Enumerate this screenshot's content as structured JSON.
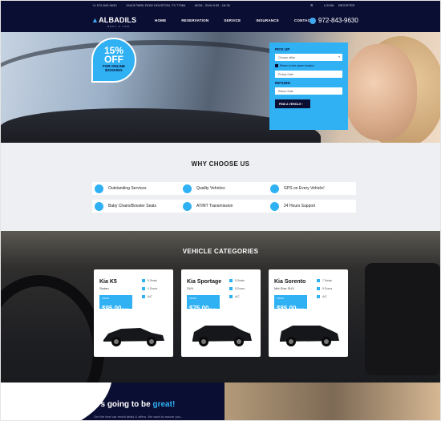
{
  "topbar": {
    "phone": "+1 972-843-9630",
    "address": "19415 PARK ROW HOUSTON, TX 77084",
    "hours": "MON - SUN 8:30 - 16:30",
    "login": "LOGIN",
    "register": "REGISTER"
  },
  "header": {
    "logo": "ALBADILS",
    "logo_sub": "RENT A CAR",
    "nav": [
      "HOME",
      "RESERVATION",
      "SERVICE",
      "INSURANCE",
      "CONTACTS"
    ],
    "phone": "972-843-9630"
  },
  "hero": {
    "badge_percent": "15%",
    "badge_off": "OFF",
    "badge_line1": "FOR ONLINE",
    "badge_line2": "BOOKING"
  },
  "booking_form": {
    "pickup_label": "PICK UP",
    "office_placeholder": "Choose office",
    "return_same": "Return to the same location",
    "pickup_date": "Pickup Date",
    "return_label": "RETURN",
    "return_date": "Return Date",
    "submit": "FIND A VEHICLE"
  },
  "why": {
    "title": "WHY CHOOSE US",
    "features": [
      "Outstanding Services",
      "Quality Vehicles",
      "GPS on Every Vehicle!",
      "Baby Chairs/Booster Seats",
      "AT/MT Transmission",
      "24 Hours Support"
    ]
  },
  "categories": {
    "title": "VEHICLE CATEGORIES",
    "cards": [
      {
        "name": "Kia K5",
        "type": "Sedan",
        "from": "FROM",
        "price": "$95.00",
        "per": "/DAY",
        "seats": "5 Seats",
        "doors": "4 Doors",
        "ac": "A/C"
      },
      {
        "name": "Kia Sportage",
        "type": "SUV",
        "from": "FROM",
        "price": "$75.00",
        "per": "/DAY",
        "seats": "5 Seats",
        "doors": "5 Doors",
        "ac": "A/C"
      },
      {
        "name": "Kia Sorento",
        "type": "Mid-Size SUV",
        "from": "FROM",
        "price": "$85.00",
        "per": "/DAY",
        "seats": "7 Seats",
        "doors": "5 Doors",
        "ac": "A/C"
      }
    ]
  },
  "bottom": {
    "tagline_start": "It's going to be ",
    "tagline_accent": "great!",
    "sub": "Get the best car rental deals & offers. We want to assure you..."
  },
  "colors": {
    "navy": "#0b0e33",
    "accent": "#2fb1f4"
  }
}
